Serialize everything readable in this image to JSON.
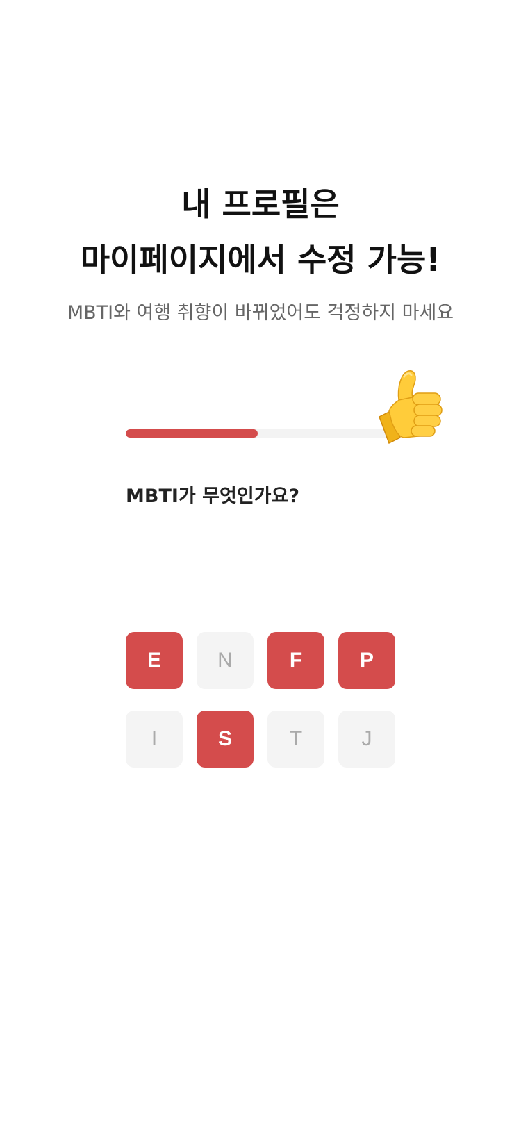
{
  "header": {
    "title_line1": "내 프로필은",
    "title_line2": "마이페이지에서 수정 가능!",
    "subtitle": "MBTI와 여행 취향이 바뀌었어도 걱정하지 마세요"
  },
  "progress": {
    "fraction": 0.49,
    "emoji_icon": "thumbs-up-icon",
    "fill_color": "#d44c4c",
    "track_color": "#f3f3f3"
  },
  "question": "MBTI가 무엇인가요?",
  "mbti": {
    "accent_color": "#d44c4c",
    "rows": [
      [
        {
          "letter": "E",
          "selected": true
        },
        {
          "letter": "N",
          "selected": false
        },
        {
          "letter": "F",
          "selected": true
        },
        {
          "letter": "P",
          "selected": true
        }
      ],
      [
        {
          "letter": "I",
          "selected": false
        },
        {
          "letter": "S",
          "selected": true
        },
        {
          "letter": "T",
          "selected": false
        },
        {
          "letter": "J",
          "selected": false
        }
      ]
    ]
  }
}
